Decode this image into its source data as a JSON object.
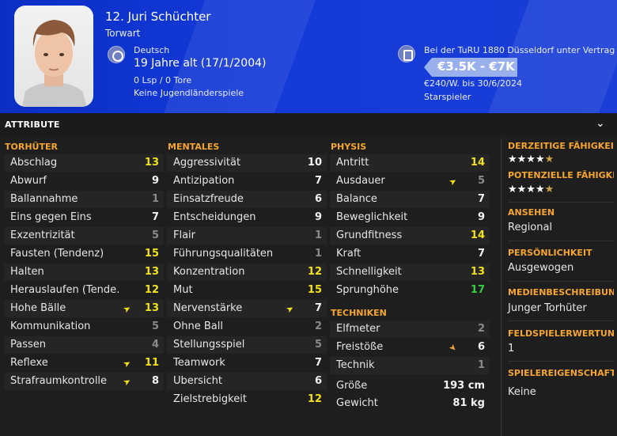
{
  "header": {
    "name": "12. Juri Schüchter",
    "role": "Torwart",
    "nationality_label": "Deutsch",
    "age": "19 Jahre alt (17/1/2004)",
    "caps": "0 Lsp / 0 Tore",
    "youth": "Keine Jugendländerspiele",
    "contract": "Bei der TuRU 1880 Düsseldorf unter Vertrag",
    "value": "€3.5K - €7K",
    "wage": "€240/W. bis 30/6/2024",
    "status": "Starspieler",
    "colors": {
      "banner": "#1339d8",
      "badge": "#9ab0ec"
    }
  },
  "attributes": {
    "title": "ATTRIBUTE",
    "goalkeeping": {
      "title": "TORHÜTER",
      "rows": [
        {
          "label": "Abschlag",
          "value": "13",
          "color": "yellow",
          "arrow": ""
        },
        {
          "label": "Abwurf",
          "value": "9",
          "color": "white",
          "arrow": ""
        },
        {
          "label": "Ballannahme",
          "value": "1",
          "color": "grey",
          "arrow": ""
        },
        {
          "label": "Eins gegen Eins",
          "value": "7",
          "color": "white",
          "arrow": ""
        },
        {
          "label": "Exzentrizität",
          "value": "5",
          "color": "grey",
          "arrow": ""
        },
        {
          "label": "Fausten (Tendenz)",
          "value": "15",
          "color": "yellow",
          "arrow": ""
        },
        {
          "label": "Halten",
          "value": "13",
          "color": "yellow",
          "arrow": ""
        },
        {
          "label": "Herauslaufen (Tende…",
          "value": "12",
          "color": "yellow",
          "arrow": ""
        },
        {
          "label": "Hohe Bälle",
          "value": "13",
          "color": "yellow",
          "arrow": "up-yellow"
        },
        {
          "label": "Kommunikation",
          "value": "5",
          "color": "grey",
          "arrow": ""
        },
        {
          "label": "Passen",
          "value": "4",
          "color": "grey",
          "arrow": ""
        },
        {
          "label": "Reflexe",
          "value": "11",
          "color": "yellow",
          "arrow": "up-yellow"
        },
        {
          "label": "Strafraumkontrolle",
          "value": "8",
          "color": "white",
          "arrow": "up-yellow"
        }
      ]
    },
    "mental": {
      "title": "MENTALES",
      "rows": [
        {
          "label": "Aggressivität",
          "value": "10",
          "color": "white",
          "arrow": ""
        },
        {
          "label": "Antizipation",
          "value": "7",
          "color": "white",
          "arrow": ""
        },
        {
          "label": "Einsatzfreude",
          "value": "6",
          "color": "white",
          "arrow": ""
        },
        {
          "label": "Entscheidungen",
          "value": "9",
          "color": "white",
          "arrow": ""
        },
        {
          "label": "Flair",
          "value": "1",
          "color": "grey",
          "arrow": ""
        },
        {
          "label": "Führungsqualitäten",
          "value": "1",
          "color": "grey",
          "arrow": ""
        },
        {
          "label": "Konzentration",
          "value": "12",
          "color": "yellow",
          "arrow": ""
        },
        {
          "label": "Mut",
          "value": "15",
          "color": "yellow",
          "arrow": ""
        },
        {
          "label": "Nervenstärke",
          "value": "7",
          "color": "white",
          "arrow": "up-yellow"
        },
        {
          "label": "Ohne Ball",
          "value": "2",
          "color": "grey",
          "arrow": ""
        },
        {
          "label": "Stellungsspiel",
          "value": "5",
          "color": "grey",
          "arrow": ""
        },
        {
          "label": "Teamwork",
          "value": "7",
          "color": "white",
          "arrow": ""
        },
        {
          "label": "Übersicht",
          "value": "6",
          "color": "white",
          "arrow": ""
        },
        {
          "label": "Zielstrebigkeit",
          "value": "12",
          "color": "yellow",
          "arrow": ""
        }
      ]
    },
    "physical": {
      "title": "PHYSIS",
      "rows": [
        {
          "label": "Antritt",
          "value": "14",
          "color": "yellow",
          "arrow": ""
        },
        {
          "label": "Ausdauer",
          "value": "5",
          "color": "grey",
          "arrow": "up-yellow"
        },
        {
          "label": "Balance",
          "value": "7",
          "color": "white",
          "arrow": ""
        },
        {
          "label": "Beweglichkeit",
          "value": "9",
          "color": "white",
          "arrow": ""
        },
        {
          "label": "Grundfitness",
          "value": "14",
          "color": "yellow",
          "arrow": ""
        },
        {
          "label": "Kraft",
          "value": "7",
          "color": "white",
          "arrow": ""
        },
        {
          "label": "Schnelligkeit",
          "value": "13",
          "color": "yellow",
          "arrow": ""
        },
        {
          "label": "Sprunghöhe",
          "value": "17",
          "color": "green",
          "arrow": ""
        }
      ]
    },
    "technical": {
      "title": "TECHNIKEN",
      "rows": [
        {
          "label": "Elfmeter",
          "value": "2",
          "color": "grey",
          "arrow": ""
        },
        {
          "label": "Freistöße",
          "value": "6",
          "color": "white",
          "arrow": "up-orange"
        },
        {
          "label": "Technik",
          "value": "1",
          "color": "grey",
          "arrow": ""
        }
      ]
    },
    "body": [
      {
        "label": "Größe",
        "value": "193 cm"
      },
      {
        "label": "Gewicht",
        "value": "81 kg"
      }
    ]
  },
  "sidebar": {
    "current_ability": {
      "title": "DERZEITIGE FÄHIGKEIT",
      "stars": 4.5
    },
    "potential_ability": {
      "title": "POTENZIELLE FÄHIGKEIT",
      "stars": 4.5
    },
    "reputation": {
      "title": "ANSEHEN",
      "value": "Regional"
    },
    "personality": {
      "title": "PERSÖNLICHKEIT",
      "value": "Ausgewogen"
    },
    "media": {
      "title": "MEDIENBESCHREIBUNG",
      "value": "Junger Torhüter"
    },
    "outfield": {
      "title": "FELDSPIELERWERTUNG",
      "value": "1"
    },
    "traits": {
      "title": "SPIELEREIGENSCHAFTEN",
      "value": "Keine"
    }
  }
}
